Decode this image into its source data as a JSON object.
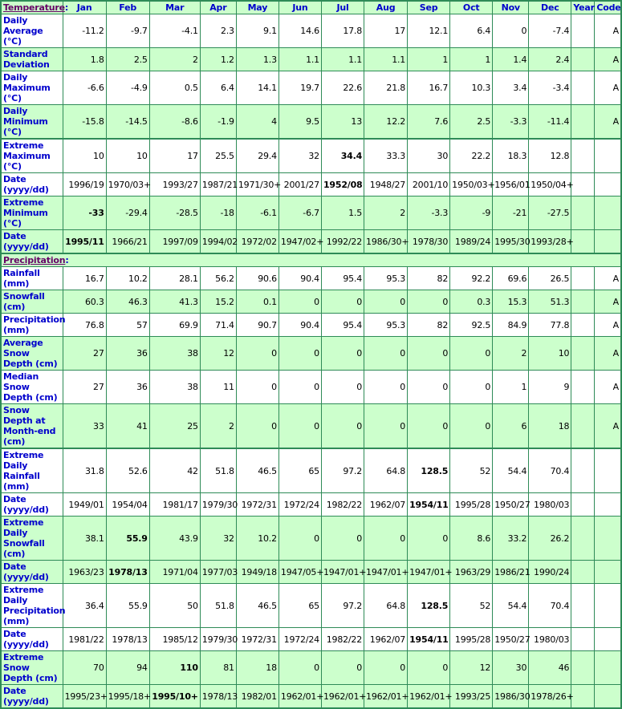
{
  "header": {
    "temperature_section": "Temperature",
    "colon": ":",
    "months": [
      "Jan",
      "Feb",
      "Mar",
      "Apr",
      "May",
      "Jun",
      "Jul",
      "Aug",
      "Sep",
      "Oct",
      "Nov",
      "Dec"
    ],
    "year": "Year",
    "code": "Code"
  },
  "temperature": [
    {
      "label": "Daily Average (°C)",
      "shade": "white",
      "values": [
        "-11.2",
        "-9.7",
        "-4.1",
        "2.3",
        "9.1",
        "14.6",
        "17.8",
        "17",
        "12.1",
        "6.4",
        "0",
        "-7.4"
      ],
      "year": "",
      "code": "A",
      "bold": []
    },
    {
      "label": "Standard Deviation",
      "shade": "green",
      "values": [
        "1.8",
        "2.5",
        "2",
        "1.2",
        "1.3",
        "1.1",
        "1.1",
        "1.1",
        "1",
        "1",
        "1.4",
        "2.4"
      ],
      "year": "",
      "code": "A",
      "bold": []
    },
    {
      "label": "Daily Maximum (°C)",
      "shade": "white",
      "values": [
        "-6.6",
        "-4.9",
        "0.5",
        "6.4",
        "14.1",
        "19.7",
        "22.6",
        "21.8",
        "16.7",
        "10.3",
        "3.4",
        "-3.4"
      ],
      "year": "",
      "code": "A",
      "bold": []
    },
    {
      "label": "Daily Minimum (°C)",
      "shade": "green",
      "values": [
        "-15.8",
        "-14.5",
        "-8.6",
        "-1.9",
        "4",
        "9.5",
        "13",
        "12.2",
        "7.6",
        "2.5",
        "-3.3",
        "-11.4"
      ],
      "year": "",
      "code": "A",
      "bold": [],
      "groupend": true
    },
    {
      "label": "Extreme Maximum (°C)",
      "shade": "white",
      "values": [
        "10",
        "10",
        "17",
        "25.5",
        "29.4",
        "32",
        "34.4",
        "33.3",
        "30",
        "22.2",
        "18.3",
        "12.8"
      ],
      "year": "",
      "code": "",
      "bold": [
        6
      ]
    },
    {
      "label": "Date (yyyy/dd)",
      "shade": "white",
      "values": [
        "1996/19",
        "1970/03+",
        "1993/27",
        "1987/21",
        "1971/30+",
        "2001/27",
        "1952/08",
        "1948/27",
        "2001/10",
        "1950/03+",
        "1956/01",
        "1950/04+"
      ],
      "year": "",
      "code": "",
      "bold": [
        6
      ]
    },
    {
      "label": "Extreme Minimum (°C)",
      "shade": "green",
      "values": [
        "-33",
        "-29.4",
        "-28.5",
        "-18",
        "-6.1",
        "-6.7",
        "1.5",
        "2",
        "-3.3",
        "-9",
        "-21",
        "-27.5"
      ],
      "year": "",
      "code": "",
      "bold": [
        0
      ]
    },
    {
      "label": "Date (yyyy/dd)",
      "shade": "green",
      "values": [
        "1995/11",
        "1966/21",
        "1997/09",
        "1994/02",
        "1972/02",
        "1947/02+",
        "1992/22",
        "1986/30+",
        "1978/30",
        "1989/24",
        "1995/30",
        "1993/28+"
      ],
      "year": "",
      "code": "",
      "bold": [
        0
      ],
      "groupend": true
    }
  ],
  "precipitation_section": "Precipitation",
  "precipitation": [
    {
      "label": "Rainfall (mm)",
      "shade": "white",
      "values": [
        "16.7",
        "10.2",
        "28.1",
        "56.2",
        "90.6",
        "90.4",
        "95.4",
        "95.3",
        "82",
        "92.2",
        "69.6",
        "26.5"
      ],
      "year": "",
      "code": "A",
      "bold": []
    },
    {
      "label": "Snowfall (cm)",
      "shade": "green",
      "values": [
        "60.3",
        "46.3",
        "41.3",
        "15.2",
        "0.1",
        "0",
        "0",
        "0",
        "0",
        "0.3",
        "15.3",
        "51.3"
      ],
      "year": "",
      "code": "A",
      "bold": []
    },
    {
      "label": "Precipitation (mm)",
      "shade": "white",
      "values": [
        "76.8",
        "57",
        "69.9",
        "71.4",
        "90.7",
        "90.4",
        "95.4",
        "95.3",
        "82",
        "92.5",
        "84.9",
        "77.8"
      ],
      "year": "",
      "code": "A",
      "bold": []
    },
    {
      "label": "Average Snow Depth (cm)",
      "shade": "green",
      "values": [
        "27",
        "36",
        "38",
        "12",
        "0",
        "0",
        "0",
        "0",
        "0",
        "0",
        "2",
        "10"
      ],
      "year": "",
      "code": "A",
      "bold": []
    },
    {
      "label": "Median Snow Depth (cm)",
      "shade": "white",
      "values": [
        "27",
        "36",
        "38",
        "11",
        "0",
        "0",
        "0",
        "0",
        "0",
        "0",
        "1",
        "9"
      ],
      "year": "",
      "code": "A",
      "bold": []
    },
    {
      "label": "Snow Depth at Month-end (cm)",
      "shade": "green",
      "values": [
        "33",
        "41",
        "25",
        "2",
        "0",
        "0",
        "0",
        "0",
        "0",
        "0",
        "6",
        "18"
      ],
      "year": "",
      "code": "A",
      "bold": [],
      "groupend": true
    },
    {
      "label": "Extreme Daily Rainfall (mm)",
      "shade": "white",
      "values": [
        "31.8",
        "52.6",
        "42",
        "51.8",
        "46.5",
        "65",
        "97.2",
        "64.8",
        "128.5",
        "52",
        "54.4",
        "70.4"
      ],
      "year": "",
      "code": "",
      "bold": [
        8
      ]
    },
    {
      "label": "Date (yyyy/dd)",
      "shade": "white",
      "values": [
        "1949/01",
        "1954/04",
        "1981/17",
        "1979/30",
        "1972/31",
        "1972/24",
        "1982/22",
        "1962/07",
        "1954/11",
        "1995/28",
        "1950/27",
        "1980/03"
      ],
      "year": "",
      "code": "",
      "bold": [
        8
      ]
    },
    {
      "label": "Extreme Daily Snowfall (cm)",
      "shade": "green",
      "values": [
        "38.1",
        "55.9",
        "43.9",
        "32",
        "10.2",
        "0",
        "0",
        "0",
        "0",
        "8.6",
        "33.2",
        "26.2"
      ],
      "year": "",
      "code": "",
      "bold": [
        1
      ]
    },
    {
      "label": "Date (yyyy/dd)",
      "shade": "green",
      "values": [
        "1963/23",
        "1978/13",
        "1971/04",
        "1977/03",
        "1949/18",
        "1947/05+",
        "1947/01+",
        "1947/01+",
        "1947/01+",
        "1963/29",
        "1986/21",
        "1990/24"
      ],
      "year": "",
      "code": "",
      "bold": [
        1
      ]
    },
    {
      "label": "Extreme Daily Precipitation (mm)",
      "shade": "white",
      "values": [
        "36.4",
        "55.9",
        "50",
        "51.8",
        "46.5",
        "65",
        "97.2",
        "64.8",
        "128.5",
        "52",
        "54.4",
        "70.4"
      ],
      "year": "",
      "code": "",
      "bold": [
        8
      ]
    },
    {
      "label": "Date (yyyy/dd)",
      "shade": "white",
      "values": [
        "1981/22",
        "1978/13",
        "1985/12",
        "1979/30",
        "1972/31",
        "1972/24",
        "1982/22",
        "1962/07",
        "1954/11",
        "1995/28",
        "1950/27",
        "1980/03"
      ],
      "year": "",
      "code": "",
      "bold": [
        8
      ]
    },
    {
      "label": "Extreme Snow Depth (cm)",
      "shade": "green",
      "values": [
        "70",
        "94",
        "110",
        "81",
        "18",
        "0",
        "0",
        "0",
        "0",
        "12",
        "30",
        "46"
      ],
      "year": "",
      "code": "",
      "bold": [
        2
      ]
    },
    {
      "label": "Date (yyyy/dd)",
      "shade": "green",
      "values": [
        "1995/23+",
        "1995/18+",
        "1995/10+",
        "1978/13",
        "1982/01",
        "1962/01+",
        "1962/01+",
        "1962/01+",
        "1962/01+",
        "1993/25",
        "1986/30",
        "1978/26+"
      ],
      "year": "",
      "code": "",
      "bold": [
        2
      ]
    }
  ]
}
